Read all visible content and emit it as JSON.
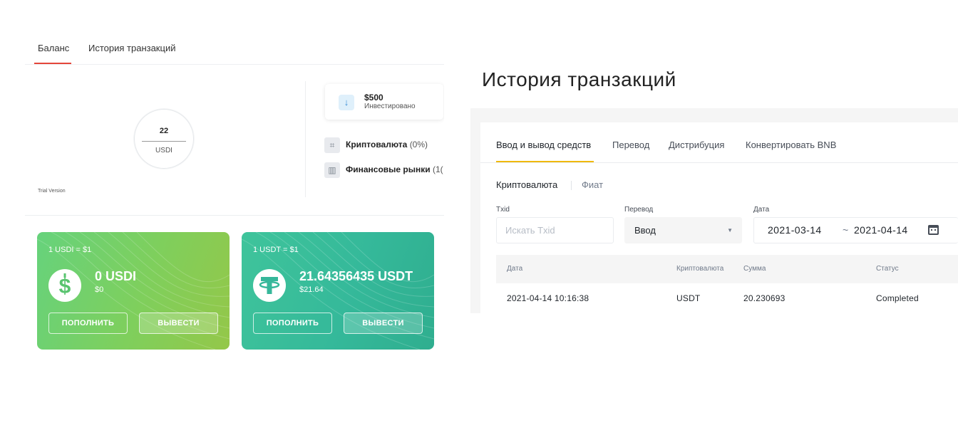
{
  "balance_panel": {
    "tabs": [
      "Баланс",
      "История транзакций"
    ],
    "donut": {
      "value": "22",
      "unit": "USDI"
    },
    "trial_label": "Trial Version",
    "invested": {
      "amount": "$500",
      "label": "Инвестировано",
      "icon": "arrow-down-icon"
    },
    "categories": [
      {
        "name": "Криптовалюта",
        "pct": "(0%)",
        "icon": "crypto-icon"
      },
      {
        "name": "Финансовые рынки",
        "pct": "(1(",
        "icon": "markets-icon"
      }
    ],
    "cards": [
      {
        "rate": "1 USDI = $1",
        "balance": "0 USDI",
        "usd": "$0",
        "deposit": "ПОПОЛНИТЬ",
        "withdraw": "ВЫВЕСТИ",
        "icon": "dollar-coin-icon"
      },
      {
        "rate": "1 USDT = $1",
        "balance": "21.64356435 USDT",
        "usd": "$21.64",
        "deposit": "ПОПОЛНИТЬ",
        "withdraw": "ВЫВЕСТИ",
        "icon": "tether-coin-icon"
      }
    ],
    "colors": {
      "tab_accent": "#e4463a",
      "card_green": "#7fcf5c",
      "card_teal": "#35b99a"
    }
  },
  "history_panel": {
    "title": "История транзакций",
    "tabs": [
      "Ввод и вывод средств",
      "Перевод",
      "Дистрибуция",
      "Конвертировать BNB"
    ],
    "subtabs": [
      "Криптовалюта",
      "Фиат"
    ],
    "filters": {
      "txid_label": "Txid",
      "txid_placeholder": "Искать Txid",
      "transfer_label": "Перевод",
      "transfer_value": "Ввод",
      "date_label": "Дата",
      "date_from": "2021-03-14",
      "date_sep": "~",
      "date_to": "2021-04-14"
    },
    "columns": [
      "Дата",
      "Криптовалюта",
      "Сумма",
      "Статус"
    ],
    "rows": [
      {
        "date": "2021-04-14 10:16:38",
        "crypto": "USDT",
        "amount": "20.230693",
        "status": "Completed"
      }
    ],
    "colors": {
      "tab_accent": "#f0b90b"
    }
  }
}
